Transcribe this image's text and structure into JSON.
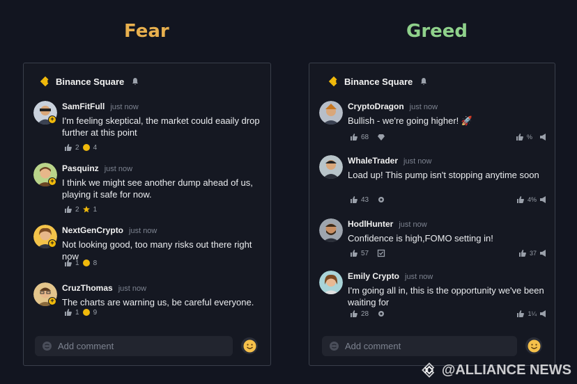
{
  "headings": {
    "fear": "Fear",
    "greed": "Greed"
  },
  "brand": {
    "name": "Binance Square",
    "logo_icon": "binance-logo-icon",
    "bell_icon": "bell-icon"
  },
  "fear_panel": {
    "posts": [
      {
        "username": "SamFitFull",
        "time": "just now",
        "text": "I'm feeling skeptical, the market could eaaily drop further at this point",
        "likes": "2",
        "shares": "4"
      },
      {
        "username": "Pasquinz",
        "time": "just now",
        "text": "I think we might see another dump ahead of us, playing it safe for now.",
        "likes": "2",
        "shares": "1"
      },
      {
        "username": "NextGenCrypto",
        "time": "just now",
        "text": "Not looking good, too many risks out there right now",
        "likes": "1",
        "shares": "8"
      },
      {
        "username": "CruzThomas",
        "time": "just now",
        "text": "The charts are warning us, be careful everyone.",
        "likes": "1",
        "shares": "9"
      }
    ],
    "comment_placeholder": "Add comment"
  },
  "greed_panel": {
    "posts": [
      {
        "username": "CryptoDragon",
        "time": "just now",
        "text": "Bullish - we're going higher! 🚀",
        "likes": "68",
        "right_count": "%"
      },
      {
        "username": "WhaleTrader",
        "time": "just now",
        "text": "Load up! This pump isn't stopping anytime soon",
        "likes": "43",
        "right_count": "4%"
      },
      {
        "username": "HodlHunter",
        "time": "just now",
        "text": "Confidence is high,FOMO setting in!",
        "likes": "57",
        "right_count": "37"
      },
      {
        "username": "Emily Crypto",
        "time": "just now",
        "text": "I'm going all in, this is the opportunity we've been waiting for",
        "likes": "28",
        "right_count": "1¼"
      }
    ],
    "comment_placeholder": "Add comment"
  },
  "watermark": {
    "text": "@ALLIANCE NEWS"
  },
  "colors": {
    "fear": "#e8b04e",
    "greed": "#8fd18b",
    "brand": "#f0b90b",
    "background": "#121520"
  }
}
